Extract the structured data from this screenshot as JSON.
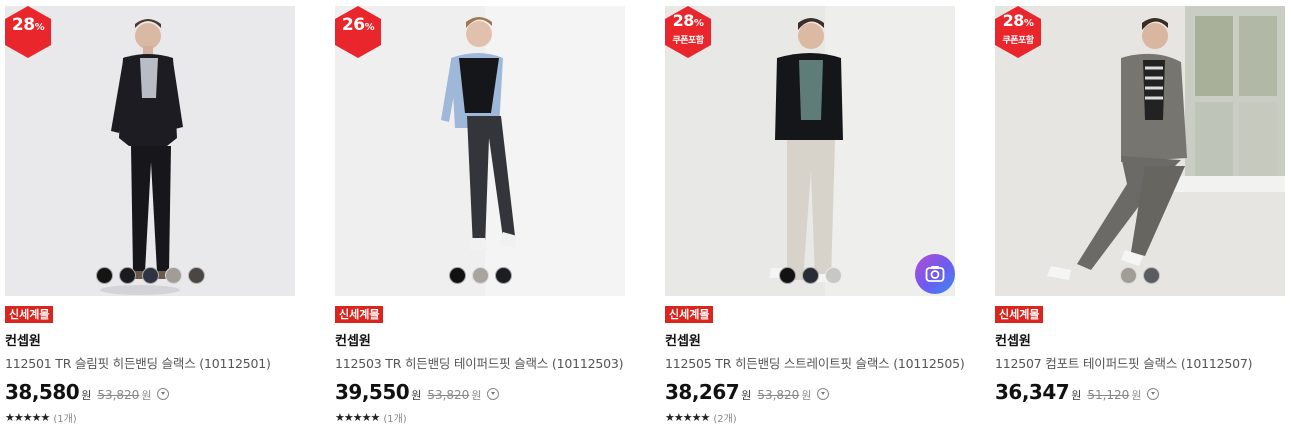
{
  "colors": {
    "badge_red": "#e8262b",
    "tag_red": "#d9251d"
  },
  "products": [
    {
      "discount": "28",
      "discount_unit": "%",
      "coupon": "",
      "bg": "#e9e9ec",
      "swatches": [
        "#141414",
        "#1b1b1f",
        "#2f3440",
        "#a09c98",
        "#4a4644"
      ],
      "tag": "신세계몰",
      "brand": "컨셉원",
      "name": "112501 TR 슬림핏 히든밴딩 슬랙스 (10112501)",
      "price": "38,580",
      "won": "원",
      "original": "53,820",
      "original_won": "원",
      "stars": "★★★★★",
      "review_count": "(1개)",
      "camera": false
    },
    {
      "discount": "26",
      "discount_unit": "%",
      "coupon": "",
      "bg": "#efefef",
      "swatches": [
        "#111111",
        "#a8a5a0",
        "#1c1d22"
      ],
      "tag": "신세계몰",
      "brand": "컨셉원",
      "name": "112503 TR 히든밴딩 테이퍼드핏 슬랙스 (10112503)",
      "price": "39,550",
      "won": "원",
      "original": "53,820",
      "original_won": "원",
      "stars": "★★★★★",
      "review_count": "(1개)",
      "camera": false
    },
    {
      "discount": "28",
      "discount_unit": "%",
      "coupon": "쿠폰포함",
      "bg": "#e8e8e6",
      "swatches": [
        "#121212",
        "#2a2c35",
        "#c9c7c4"
      ],
      "tag": "신세계몰",
      "brand": "컨셉원",
      "name": "112505 TR 히든밴딩 스트레이트핏 슬랙스 (10112505)",
      "price": "38,267",
      "won": "원",
      "original": "53,820",
      "original_won": "원",
      "stars": "★★★★★",
      "review_count": "(2개)",
      "camera": true
    },
    {
      "discount": "28",
      "discount_unit": "%",
      "coupon": "쿠폰포함",
      "bg": "#e6e5e2",
      "swatches": [
        "#a09d97",
        "#5a5c60"
      ],
      "tag": "신세계몰",
      "brand": "컨셉원",
      "name": "112507 컴포트 테이퍼드핏 슬랙스 (10112507)",
      "price": "36,347",
      "won": "원",
      "original": "51,120",
      "original_won": "원",
      "stars": "",
      "review_count": "",
      "camera": false
    }
  ]
}
